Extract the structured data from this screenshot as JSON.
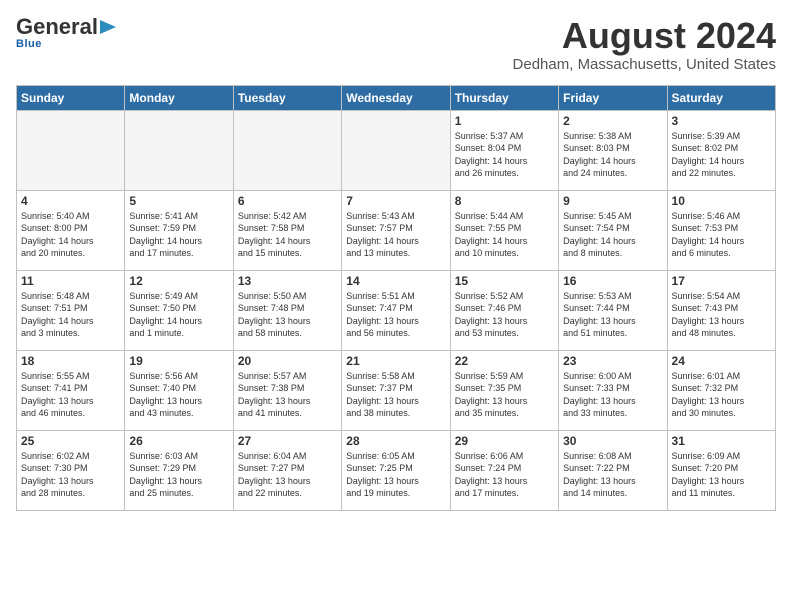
{
  "header": {
    "logo_general": "General",
    "logo_blue": "Blue",
    "month": "August 2024",
    "location": "Dedham, Massachusetts, United States"
  },
  "weekdays": [
    "Sunday",
    "Monday",
    "Tuesday",
    "Wednesday",
    "Thursday",
    "Friday",
    "Saturday"
  ],
  "weeks": [
    [
      {
        "day": "",
        "info": ""
      },
      {
        "day": "",
        "info": ""
      },
      {
        "day": "",
        "info": ""
      },
      {
        "day": "",
        "info": ""
      },
      {
        "day": "1",
        "info": "Sunrise: 5:37 AM\nSunset: 8:04 PM\nDaylight: 14 hours\nand 26 minutes."
      },
      {
        "day": "2",
        "info": "Sunrise: 5:38 AM\nSunset: 8:03 PM\nDaylight: 14 hours\nand 24 minutes."
      },
      {
        "day": "3",
        "info": "Sunrise: 5:39 AM\nSunset: 8:02 PM\nDaylight: 14 hours\nand 22 minutes."
      }
    ],
    [
      {
        "day": "4",
        "info": "Sunrise: 5:40 AM\nSunset: 8:00 PM\nDaylight: 14 hours\nand 20 minutes."
      },
      {
        "day": "5",
        "info": "Sunrise: 5:41 AM\nSunset: 7:59 PM\nDaylight: 14 hours\nand 17 minutes."
      },
      {
        "day": "6",
        "info": "Sunrise: 5:42 AM\nSunset: 7:58 PM\nDaylight: 14 hours\nand 15 minutes."
      },
      {
        "day": "7",
        "info": "Sunrise: 5:43 AM\nSunset: 7:57 PM\nDaylight: 14 hours\nand 13 minutes."
      },
      {
        "day": "8",
        "info": "Sunrise: 5:44 AM\nSunset: 7:55 PM\nDaylight: 14 hours\nand 10 minutes."
      },
      {
        "day": "9",
        "info": "Sunrise: 5:45 AM\nSunset: 7:54 PM\nDaylight: 14 hours\nand 8 minutes."
      },
      {
        "day": "10",
        "info": "Sunrise: 5:46 AM\nSunset: 7:53 PM\nDaylight: 14 hours\nand 6 minutes."
      }
    ],
    [
      {
        "day": "11",
        "info": "Sunrise: 5:48 AM\nSunset: 7:51 PM\nDaylight: 14 hours\nand 3 minutes."
      },
      {
        "day": "12",
        "info": "Sunrise: 5:49 AM\nSunset: 7:50 PM\nDaylight: 14 hours\nand 1 minute."
      },
      {
        "day": "13",
        "info": "Sunrise: 5:50 AM\nSunset: 7:48 PM\nDaylight: 13 hours\nand 58 minutes."
      },
      {
        "day": "14",
        "info": "Sunrise: 5:51 AM\nSunset: 7:47 PM\nDaylight: 13 hours\nand 56 minutes."
      },
      {
        "day": "15",
        "info": "Sunrise: 5:52 AM\nSunset: 7:46 PM\nDaylight: 13 hours\nand 53 minutes."
      },
      {
        "day": "16",
        "info": "Sunrise: 5:53 AM\nSunset: 7:44 PM\nDaylight: 13 hours\nand 51 minutes."
      },
      {
        "day": "17",
        "info": "Sunrise: 5:54 AM\nSunset: 7:43 PM\nDaylight: 13 hours\nand 48 minutes."
      }
    ],
    [
      {
        "day": "18",
        "info": "Sunrise: 5:55 AM\nSunset: 7:41 PM\nDaylight: 13 hours\nand 46 minutes."
      },
      {
        "day": "19",
        "info": "Sunrise: 5:56 AM\nSunset: 7:40 PM\nDaylight: 13 hours\nand 43 minutes."
      },
      {
        "day": "20",
        "info": "Sunrise: 5:57 AM\nSunset: 7:38 PM\nDaylight: 13 hours\nand 41 minutes."
      },
      {
        "day": "21",
        "info": "Sunrise: 5:58 AM\nSunset: 7:37 PM\nDaylight: 13 hours\nand 38 minutes."
      },
      {
        "day": "22",
        "info": "Sunrise: 5:59 AM\nSunset: 7:35 PM\nDaylight: 13 hours\nand 35 minutes."
      },
      {
        "day": "23",
        "info": "Sunrise: 6:00 AM\nSunset: 7:33 PM\nDaylight: 13 hours\nand 33 minutes."
      },
      {
        "day": "24",
        "info": "Sunrise: 6:01 AM\nSunset: 7:32 PM\nDaylight: 13 hours\nand 30 minutes."
      }
    ],
    [
      {
        "day": "25",
        "info": "Sunrise: 6:02 AM\nSunset: 7:30 PM\nDaylight: 13 hours\nand 28 minutes."
      },
      {
        "day": "26",
        "info": "Sunrise: 6:03 AM\nSunset: 7:29 PM\nDaylight: 13 hours\nand 25 minutes."
      },
      {
        "day": "27",
        "info": "Sunrise: 6:04 AM\nSunset: 7:27 PM\nDaylight: 13 hours\nand 22 minutes."
      },
      {
        "day": "28",
        "info": "Sunrise: 6:05 AM\nSunset: 7:25 PM\nDaylight: 13 hours\nand 19 minutes."
      },
      {
        "day": "29",
        "info": "Sunrise: 6:06 AM\nSunset: 7:24 PM\nDaylight: 13 hours\nand 17 minutes."
      },
      {
        "day": "30",
        "info": "Sunrise: 6:08 AM\nSunset: 7:22 PM\nDaylight: 13 hours\nand 14 minutes."
      },
      {
        "day": "31",
        "info": "Sunrise: 6:09 AM\nSunset: 7:20 PM\nDaylight: 13 hours\nand 11 minutes."
      }
    ]
  ]
}
